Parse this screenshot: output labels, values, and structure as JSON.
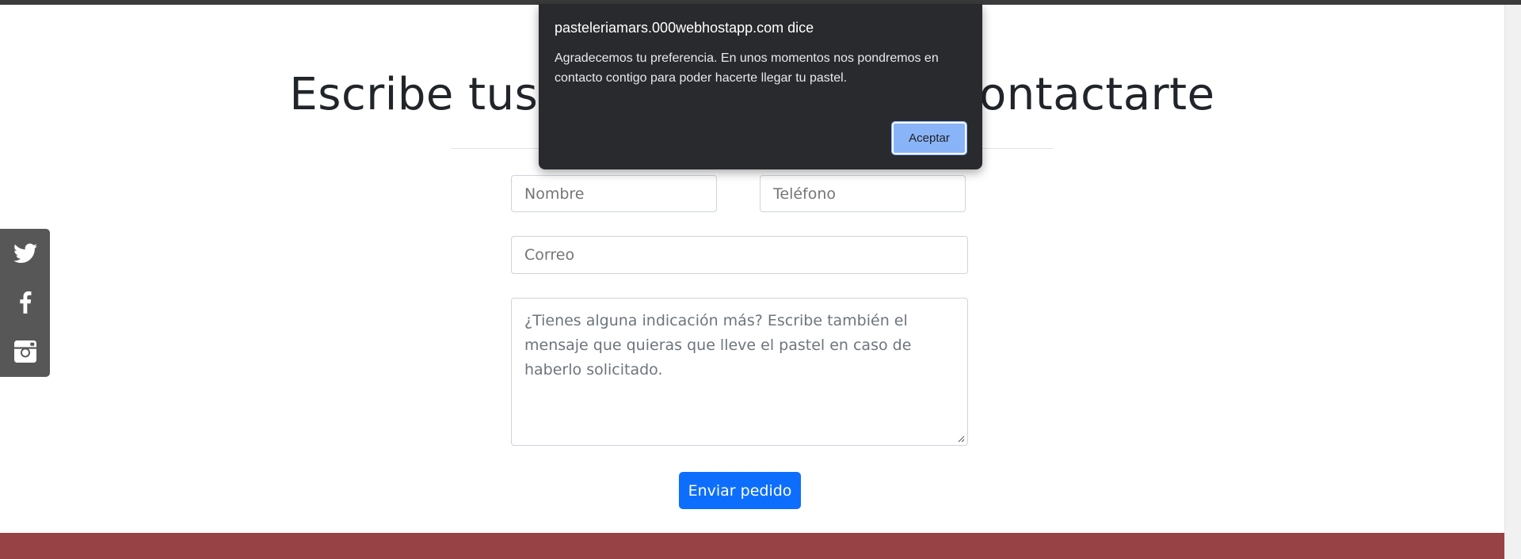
{
  "page": {
    "heading": "Escribe tus datos para poder contactarte"
  },
  "form": {
    "nombre_placeholder": "Nombre",
    "telefono_placeholder": "Teléfono",
    "correo_placeholder": "Correo",
    "mensaje_placeholder": "¿Tienes alguna indicación más? Escribe también el mensaje que quieras que lleve el pastel en caso de haberlo solicitado.",
    "submit_label": "Enviar pedido"
  },
  "social": {
    "items": [
      {
        "icon": "twitter-icon"
      },
      {
        "icon": "facebook-icon"
      },
      {
        "icon": "instagram-icon"
      }
    ]
  },
  "dialog": {
    "title": "pasteleriamars.000webhostapp.com dice",
    "message": "Agradecemos tu preferencia. En unos momentos nos pondremos en contacto contigo para poder hacerte llegar tu pastel.",
    "ok_label": "Aceptar"
  },
  "colors": {
    "primary_button": "#0d6efd",
    "footer": "#974245",
    "social_bar": "#575757",
    "dialog_bg": "#292a2d",
    "dialog_button": "#8ab4f8"
  }
}
